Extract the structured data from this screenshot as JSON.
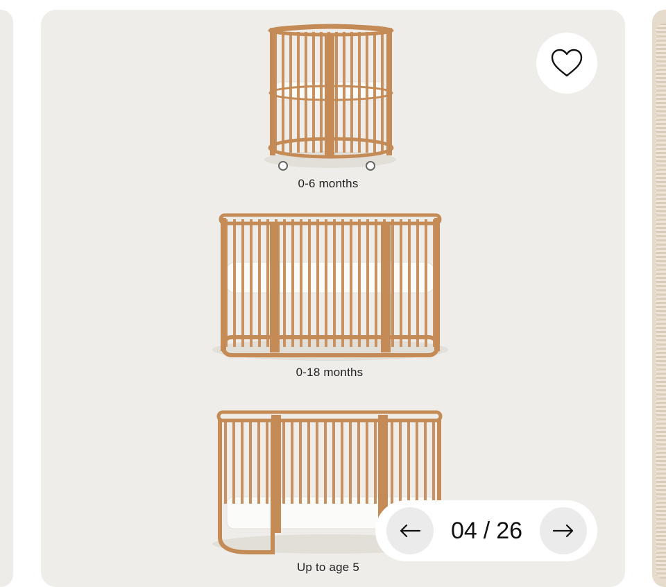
{
  "product_gallery": {
    "slides": [
      {
        "label": "0-6 months"
      },
      {
        "label": "0-18 months"
      },
      {
        "label": "Up to age 5"
      }
    ],
    "favorite_icon": "heart-outline-icon",
    "pager": {
      "current": "04",
      "separator": "/",
      "total": "26",
      "prev_icon": "arrow-left-icon",
      "next_icon": "arrow-right-icon"
    }
  },
  "colors": {
    "card_background": "#efedea",
    "wood": "#c9915f",
    "mattress": "#ffffff"
  }
}
